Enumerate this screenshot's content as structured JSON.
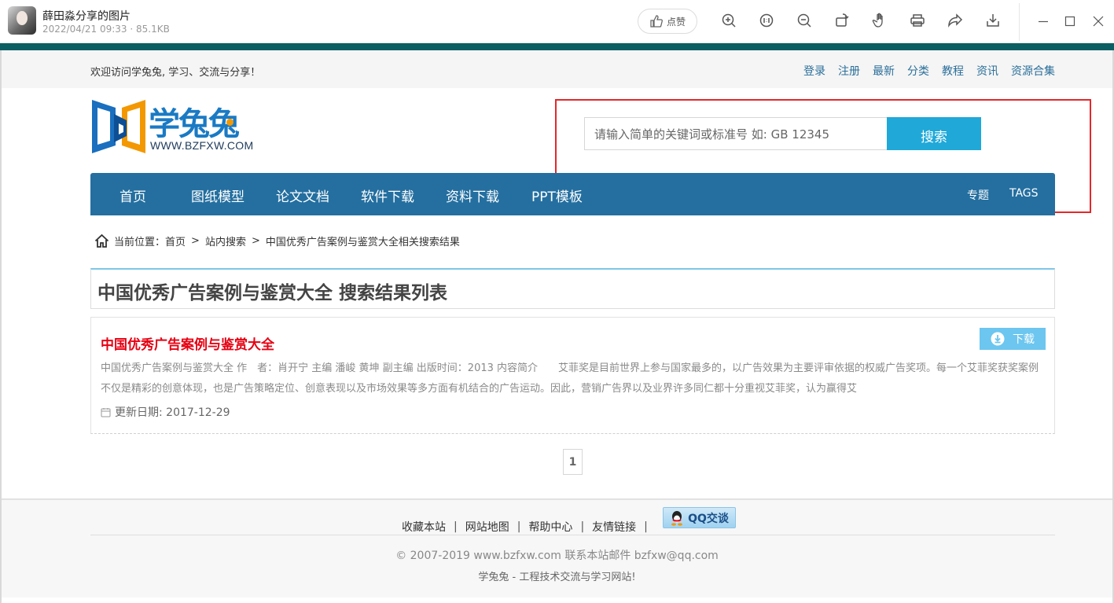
{
  "viewer": {
    "title": "薛田淼分享的图片",
    "subtitle": "2022/04/21 09:33 · 85.1KB",
    "like_label": "点赞",
    "tools": [
      "zoom-in-icon",
      "actual-size-icon",
      "zoom-out-icon",
      "rotate-icon",
      "hand-icon",
      "print-icon",
      "share-icon",
      "download-icon"
    ]
  },
  "topbar": {
    "welcome": "欢迎访问学兔兔, 学习、交流与分享！",
    "links": [
      "登录",
      "注册",
      "最新",
      "分类",
      "教程",
      "资讯",
      "资源合集"
    ]
  },
  "logo": {
    "name": "学兔兔",
    "url": "WWW.BZFXW.COM"
  },
  "search": {
    "placeholder": "请输入简单的关键词或标准号 如:   GB 12345",
    "button": "搜索"
  },
  "nav": {
    "items": [
      "首页",
      "图纸模型",
      "论文文档",
      "软件下载",
      "资料下载",
      "PPT模板"
    ],
    "right": [
      "专题",
      "TAGS"
    ]
  },
  "breadcrumb": {
    "prefix": "当前位置：",
    "items": [
      "首页",
      "站内搜索",
      "中国优秀广告案例与鉴赏大全相关搜索结果"
    ],
    "separator": ">"
  },
  "results": {
    "heading": "中国优秀广告案例与鉴赏大全 搜索结果列表",
    "items": [
      {
        "title": "中国优秀广告案例与鉴赏大全",
        "download": "下载",
        "description": "中国优秀广告案例与鉴赏大全 作　者：肖开宁 主编 潘峻 黄坤 副主编 出版时间：2013 内容简介　　艾菲奖是目前世界上参与国家最多的，以广告效果为主要评审依据的权威广告奖项。每一个艾菲奖获奖案例不仅是精彩的创意体现，也是广告策略定位、创意表现以及市场效果等多方面有机结合的广告运动。因此，营销广告界以及业界许多同仁都十分重视艾菲奖，认为赢得艾",
        "date": "更新日期: 2017-12-29"
      }
    ]
  },
  "pagination": {
    "current": "1"
  },
  "footer": {
    "links": [
      "收藏本站",
      "网站地图",
      "帮助中心",
      "友情链接"
    ],
    "qq": "QQ交谈",
    "copyright": "© 2007-2019 www.bzfxw.com 联系本站邮件 bzfxw@qq.com",
    "slogan": "学兔兔 - 工程技术交流与学习网站!"
  },
  "colors": {
    "nav": "#246fa0",
    "accent": "#1fa8d8",
    "title_red": "#e60012",
    "teal": "#0b5f63",
    "highlight": "#e4272a"
  }
}
